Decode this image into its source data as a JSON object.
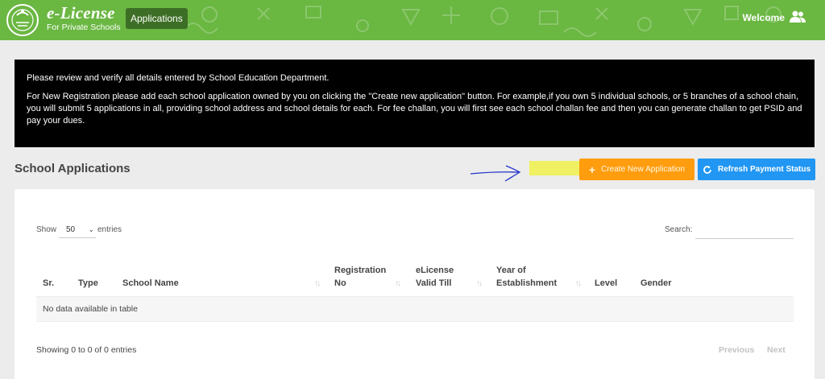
{
  "header": {
    "brand_title": "e-License",
    "brand_subtitle": "For Private Schools",
    "nav_applications": "Applications",
    "welcome_label": "Welcome",
    "user_icon": "users-icon",
    "bar_color": "#6ab742"
  },
  "notice": {
    "line1": "Please review and verify all details entered by School Education Department.",
    "line2": "For New Registration please add each school application owned by you on clicking the \"Create new application\" button. For example,if you own 5 individual schools, or 5 branches of a school chain, you will submit 5 applications in all, providing school address and school details for each. For fee challan, you will first see each school challan fee and then you can generate challan to get PSID and pay your dues."
  },
  "section": {
    "title": "School Applications"
  },
  "buttons": {
    "create_label": "Create New Application",
    "create_icon": "plus-icon",
    "create_color": "#ff9d0f",
    "refresh_label": "Refresh Payment Status",
    "refresh_icon": "refresh-icon",
    "refresh_color": "#2196f3"
  },
  "table": {
    "show_label": "Show",
    "entries_value": "50",
    "entries_label": "entries",
    "search_label": "Search:",
    "columns": [
      {
        "line1": "Sr.",
        "line2": ""
      },
      {
        "line1": "Type",
        "line2": ""
      },
      {
        "line1": "School Name",
        "line2": ""
      },
      {
        "line1": "Registration",
        "line2": "No"
      },
      {
        "line1": "eLicense",
        "line2": "Valid Till"
      },
      {
        "line1": "Year of",
        "line2": "Establishment"
      },
      {
        "line1": "Level",
        "line2": ""
      },
      {
        "line1": "Gender",
        "line2": ""
      }
    ],
    "empty_message": "No data available in table",
    "info": "Showing 0 to 0 of 0 entries",
    "previous_label": "Previous",
    "next_label": "Next"
  }
}
